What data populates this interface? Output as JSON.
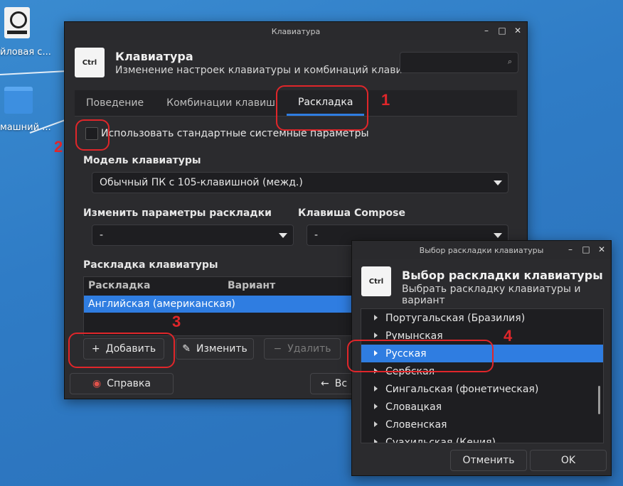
{
  "desktop": {
    "icon1_label": "йловая с...",
    "icon2_label": "машний ..."
  },
  "main_window": {
    "title": "Клавиатура",
    "header_title": "Клавиатура",
    "header_subtitle": "Изменение настроек клавиатуры и комбинаций клавиш",
    "icon_text": "Ctrl",
    "tabs": [
      "Поведение",
      "Комбинации клавиш",
      "Раскладка"
    ],
    "use_system_defaults": "Использовать стандартные системные параметры",
    "keyboard_model_label": "Модель клавиатуры",
    "keyboard_model_value": "Обычный ПК с 105-клавишной (межд.)",
    "change_layout_option_label": "Изменить параметры раскладки",
    "change_layout_option_value": "-",
    "compose_key_label": "Клавиша Compose",
    "compose_key_value": "-",
    "layout_section_label": "Раскладка клавиатуры",
    "table_headers": [
      "Раскладка",
      "Вариант"
    ],
    "table_rows": [
      "Английская (американская)"
    ],
    "add_button": "Добавить",
    "edit_button": "Изменить",
    "remove_button": "Удалить",
    "help_button": "Справка",
    "close_button_partial": "Вс"
  },
  "dialog": {
    "title": "Выбор раскладки клавиатуры",
    "header_title": "Выбор раскладки клавиатуры",
    "header_subtitle": "Выбрать раскладку клавиатуры и вариант",
    "icon_text": "Ctrl",
    "items": [
      "Португальская (Бразилия)",
      "Румынская",
      "Русская",
      "Сербская",
      "Сингальская (фонетическая)",
      "Словацкая",
      "Словенская",
      "Суахильская (Кения)"
    ],
    "selected_index": 2,
    "cancel_button": "Отменить",
    "ok_button": "OK"
  },
  "annotations": [
    "1",
    "2",
    "3",
    "4"
  ],
  "colors": {
    "accent": "#2f7de1",
    "annotation": "#e0262a",
    "desktop": "#2f7cc6"
  }
}
